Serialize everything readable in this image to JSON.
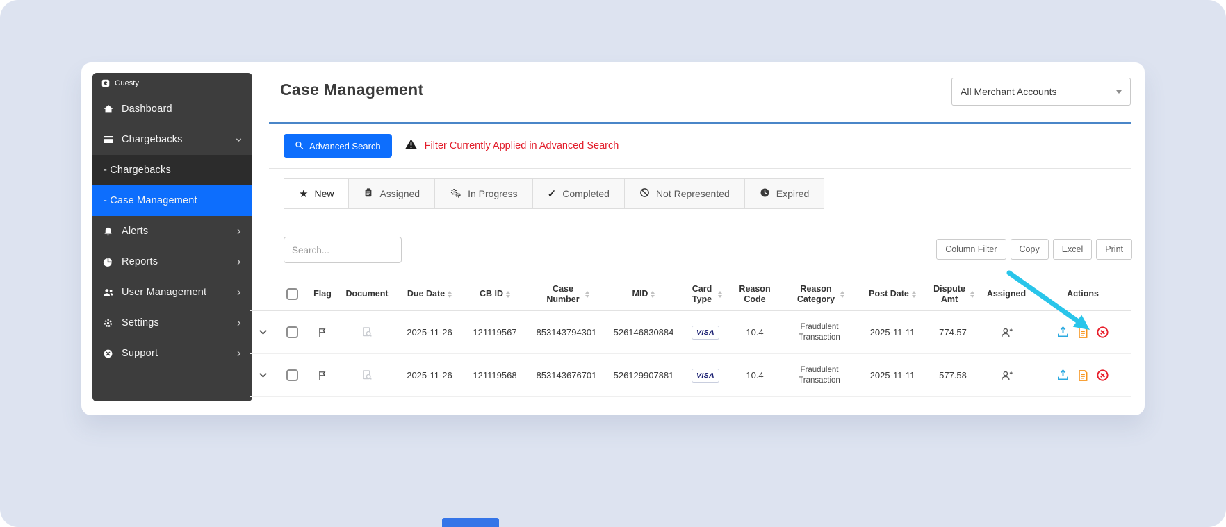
{
  "theme": {
    "canvas_bg": "#dde3f0",
    "sidebar_bg": "#3d3d3d",
    "accent_blue": "#0d6efd",
    "alert_red": "#e21c2a",
    "divider_blue": "#4a86c8",
    "action_upload": "#2aa9e0",
    "action_note": "#f7941d",
    "action_remove": "#e8202c",
    "arrow_cyan": "#29c5ea"
  },
  "sidebar": {
    "brand": "Guesty",
    "items": [
      {
        "label": "Dashboard",
        "icon": "home-icon"
      },
      {
        "label": "Chargebacks",
        "icon": "credit-card-icon",
        "expanded": true
      },
      {
        "label": "- Chargebacks",
        "type": "sub"
      },
      {
        "label": "- Case Management",
        "type": "sub",
        "active": true
      },
      {
        "label": "Alerts",
        "icon": "bell-icon"
      },
      {
        "label": "Reports",
        "icon": "pie-chart-icon"
      },
      {
        "label": "User Management",
        "icon": "users-icon"
      },
      {
        "label": "Settings",
        "icon": "gear-icon"
      },
      {
        "label": "Support",
        "icon": "circle-x-icon"
      }
    ]
  },
  "header": {
    "title": "Case Management",
    "merchant_filter": "All Merchant Accounts"
  },
  "filter_bar": {
    "advanced_search": "Advanced Search",
    "warning": "Filter Currently Applied in Advanced Search"
  },
  "tabs": [
    {
      "label": "New",
      "icon": "star-icon",
      "active": true
    },
    {
      "label": "Assigned",
      "icon": "clipboard-icon"
    },
    {
      "label": "In Progress",
      "icon": "gears-icon"
    },
    {
      "label": "Completed",
      "icon": "check-icon"
    },
    {
      "label": "Not Represented",
      "icon": "ban-icon"
    },
    {
      "label": "Expired",
      "icon": "clock-icon"
    }
  ],
  "toolbar": {
    "search_placeholder": "Search...",
    "column_filter": "Column Filter",
    "copy": "Copy",
    "excel": "Excel",
    "print": "Print"
  },
  "table": {
    "columns": [
      {
        "label": "Flag"
      },
      {
        "label": "Document"
      },
      {
        "label": "Due Date",
        "sortable": true
      },
      {
        "label": "CB ID",
        "sortable": true
      },
      {
        "label": "Case Number",
        "sortable": true
      },
      {
        "label": "MID",
        "sortable": true
      },
      {
        "label": "Card Type",
        "sortable": true
      },
      {
        "label": "Reason Code"
      },
      {
        "label": "Reason Category",
        "sortable": true
      },
      {
        "label": "Post Date",
        "sortable": true
      },
      {
        "label": "Dispute Amt",
        "sortable": true
      },
      {
        "label": "Assigned"
      },
      {
        "label": "Actions"
      }
    ],
    "rows": [
      {
        "due_date": "2025-11-26",
        "cb_id": "121119567",
        "case_number": "853143794301",
        "mid": "526146830884",
        "card_type": "VISA",
        "reason_code": "10.4",
        "reason_category": "Fraudulent Transaction",
        "post_date": "2025-11-11",
        "dispute_amt": "774.57"
      },
      {
        "due_date": "2025-11-26",
        "cb_id": "121119568",
        "case_number": "853143676701",
        "mid": "526129907881",
        "card_type": "VISA",
        "reason_code": "10.4",
        "reason_category": "Fraudulent Transaction",
        "post_date": "2025-11-11",
        "dispute_amt": "577.58"
      }
    ]
  },
  "icons": {
    "star": "★",
    "check": "✓"
  }
}
